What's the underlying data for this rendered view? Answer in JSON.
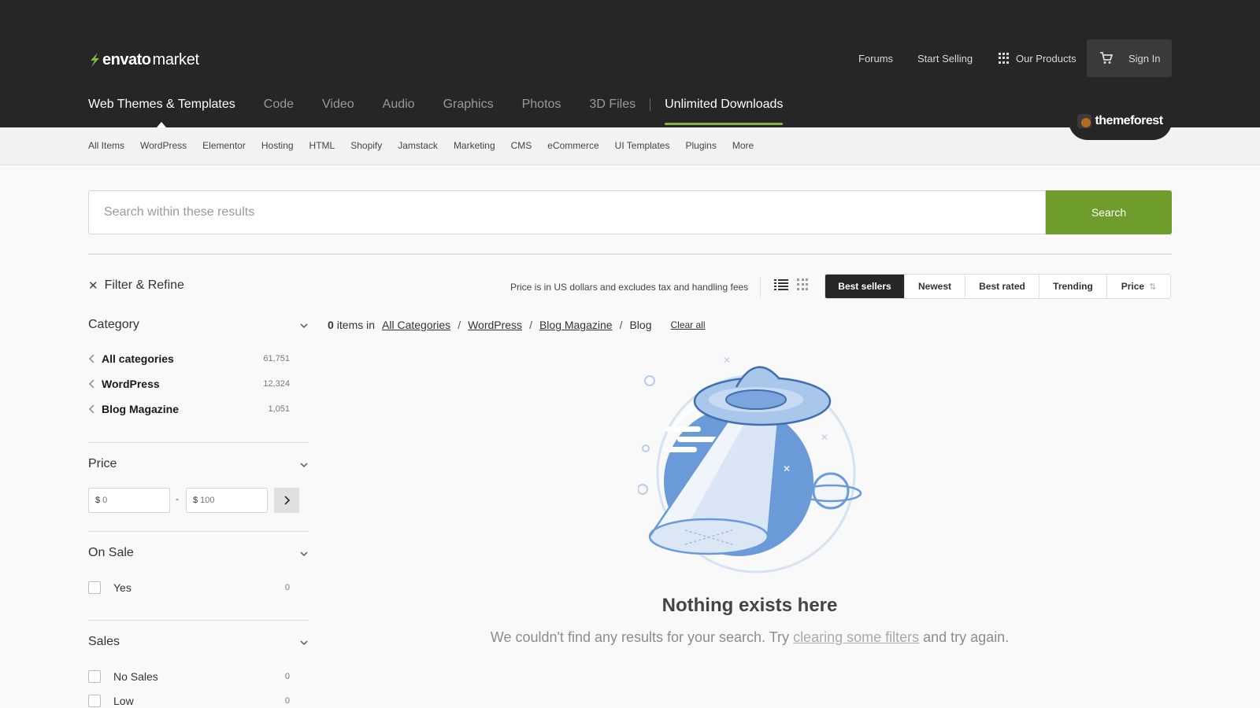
{
  "header": {
    "brand_bold": "envato",
    "brand_light": "market",
    "forums": "Forums",
    "start_selling": "Start Selling",
    "our_products": "Our Products",
    "sign_in": "Sign In",
    "themeforest": "themeforest",
    "accent_color": "#82b541"
  },
  "main_nav": {
    "items": [
      "Web Themes & Templates",
      "Code",
      "Video",
      "Audio",
      "Graphics",
      "Photos",
      "3D Files"
    ],
    "unlimited": "Unlimited Downloads"
  },
  "sub_nav": {
    "items": [
      "All Items",
      "WordPress",
      "Elementor",
      "Hosting",
      "HTML",
      "Shopify",
      "Jamstack",
      "Marketing",
      "CMS",
      "eCommerce",
      "UI Templates",
      "Plugins",
      "More"
    ]
  },
  "search": {
    "placeholder": "Search within these results",
    "button": "Search",
    "button_color": "#6f9d2c"
  },
  "filters": {
    "title": "Filter & Refine",
    "category": {
      "title": "Category",
      "items": [
        {
          "label": "All categories",
          "count": "61,751"
        },
        {
          "label": "WordPress",
          "count": "12,324"
        },
        {
          "label": "Blog Magazine",
          "count": "1,051"
        }
      ]
    },
    "price": {
      "title": "Price",
      "currency": "$",
      "min_placeholder": "0",
      "max_placeholder": "100",
      "dash": "-"
    },
    "on_sale": {
      "title": "On Sale",
      "items": [
        {
          "label": "Yes",
          "count": "0"
        }
      ]
    },
    "sales": {
      "title": "Sales",
      "items": [
        {
          "label": "No Sales",
          "count": "0"
        },
        {
          "label": "Low",
          "count": "0"
        }
      ]
    }
  },
  "results": {
    "price_note": "Price is in US dollars and excludes tax and handling fees",
    "sort": [
      "Best sellers",
      "Newest",
      "Best rated",
      "Trending",
      "Price"
    ],
    "active_sort": "Best sellers",
    "count": "0",
    "items_in": "items in",
    "breadcrumb": [
      "All Categories",
      "WordPress",
      "Blog Magazine",
      "Blog"
    ],
    "clear_all": "Clear all",
    "empty_title": "Nothing exists here",
    "empty_sub_before": "We couldn't find any results for your search. Try ",
    "empty_sub_link": "clearing some filters",
    "empty_sub_after": " and try again."
  }
}
